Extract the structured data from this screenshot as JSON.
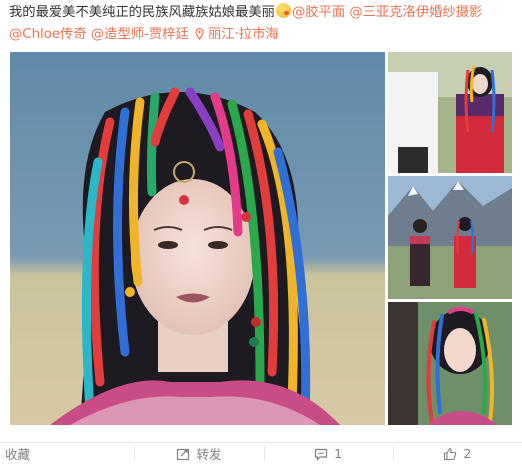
{
  "post": {
    "text_main": "我的最爱美不美纯正的民族风藏族姑娘最美丽",
    "mention_1": "@胶平面",
    "mention_2": "@三亚克洛伊婚纱摄影",
    "mention_3": "@Chloe传奇",
    "mention_4": "@造型师-贾梓廷",
    "location": "丽江·拉市海"
  },
  "photos": [
    {
      "name": "main-photo",
      "description_icon": "portrait-photo"
    },
    {
      "name": "thumb-1"
    },
    {
      "name": "thumb-2"
    },
    {
      "name": "thumb-3"
    }
  ],
  "actions": {
    "favorite_label": "收藏",
    "repost_label": "转发",
    "comment_count": "1",
    "like_count": "2"
  },
  "colors": {
    "accent": "#eb7350",
    "text": "#333333",
    "muted": "#808080"
  }
}
